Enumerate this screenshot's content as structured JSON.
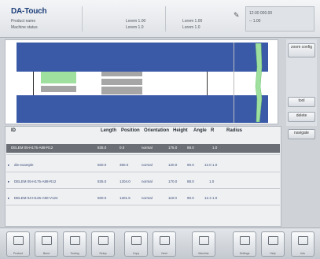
{
  "header": {
    "logo": "DA-Touch",
    "line1_left": "Product name",
    "line2_left": "Machine status",
    "col2_top": "Lorem 1.00",
    "col2_bottom": "Lorem 1.0",
    "col3_top": "Lorem 1.00",
    "col3_bottom": "Lorem 1.0",
    "status_line1": "12:00   000.00",
    "status_line2": "--        1.00"
  },
  "side_buttons": [
    "zoom config",
    "tool",
    "delete",
    "navigate"
  ],
  "table": {
    "columns": [
      "ID",
      "Length",
      "Position",
      "Orientation",
      "Height",
      "Angle",
      "R",
      "Radius"
    ],
    "selected_row": {
      "id": "DELEM 05-H175-A88-R12",
      "length": "835.0",
      "position": "0.0",
      "orientation": "normal",
      "height": "175.0",
      "angle": "88.0",
      "r": "1.0"
    },
    "rows": [
      {
        "id": "die-example",
        "length": "500.0",
        "position": "350.0",
        "orientation": "normal",
        "height": "120.0",
        "angle": "90.0",
        "r": "12.0 1.0"
      },
      {
        "id": "DELEM 05-H175-A88-R12",
        "length": "835.0",
        "position": "1204.0",
        "orientation": "normal",
        "height": "170.0",
        "angle": "88.0",
        "r": "1.0"
      },
      {
        "id": "DELEM 04-H125-A90-V124",
        "length": "500.0",
        "position": "1201.5",
        "orientation": "normal",
        "height": "110.0",
        "angle": "90.0",
        "r": "12.4 1.0"
      }
    ]
  },
  "toolbar": {
    "buttons": [
      {
        "label": "Product",
        "icon": "product-icon"
      },
      {
        "label": "Bend",
        "icon": "bend-icon"
      },
      {
        "label": "Tooling",
        "icon": "tooling-icon"
      },
      {
        "label": "Setup",
        "icon": "setup-icon"
      },
      {
        "label": "Copy",
        "icon": "copy-icon"
      },
      {
        "label": "Next",
        "icon": "next-icon"
      },
      {
        "label": "Machine",
        "icon": "machine-icon"
      },
      {
        "label": "Settings",
        "icon": "settings-icon"
      },
      {
        "label": "Help",
        "icon": "help-icon"
      },
      {
        "label": "Info",
        "icon": "info-icon"
      }
    ]
  },
  "colors": {
    "band": "#3a5aa8",
    "tool_green": "#9fe09f",
    "tool_gray": "#a6a6a6",
    "selected_row": "#6b6f75"
  }
}
